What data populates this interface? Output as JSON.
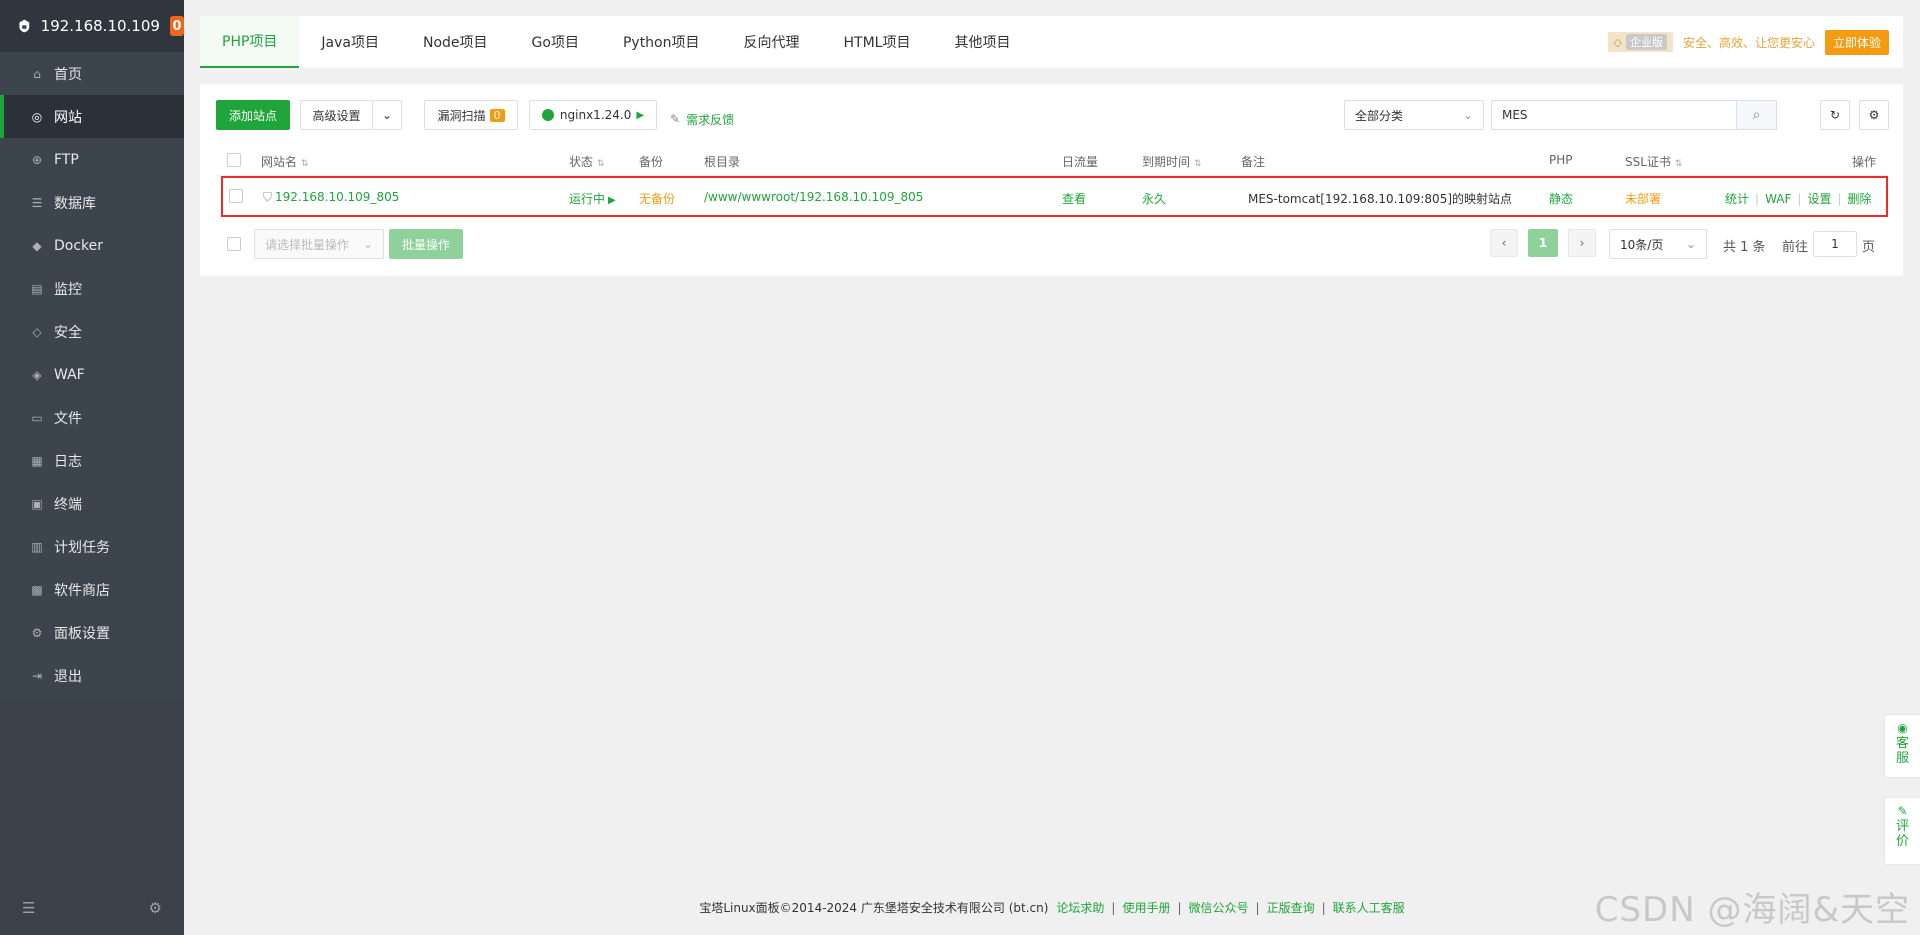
{
  "sidebar": {
    "host": "192.168.10.109",
    "badge": "0",
    "items": [
      {
        "label": "首页",
        "icon": "home-icon"
      },
      {
        "label": "网站",
        "icon": "globe-icon",
        "active": true
      },
      {
        "label": "FTP",
        "icon": "ftp-icon"
      },
      {
        "label": "数据库",
        "icon": "database-icon"
      },
      {
        "label": "Docker",
        "icon": "docker-icon"
      },
      {
        "label": "监控",
        "icon": "monitor-icon"
      },
      {
        "label": "安全",
        "icon": "shield-icon"
      },
      {
        "label": "WAF",
        "icon": "waf-icon"
      },
      {
        "label": "文件",
        "icon": "folder-icon"
      },
      {
        "label": "日志",
        "icon": "log-icon"
      },
      {
        "label": "终端",
        "icon": "terminal-icon"
      },
      {
        "label": "计划任务",
        "icon": "schedule-icon"
      },
      {
        "label": "软件商店",
        "icon": "store-icon"
      },
      {
        "label": "面板设置",
        "icon": "settings-icon"
      },
      {
        "label": "退出",
        "icon": "logout-icon"
      }
    ]
  },
  "tabs": [
    "PHP项目",
    "Java项目",
    "Node项目",
    "Go项目",
    "Python项目",
    "反向代理",
    "HTML项目",
    "其他项目"
  ],
  "promo": {
    "edition": "企业版",
    "slogan": "安全、高效、让您更安心",
    "try_label": "立即体验"
  },
  "toolbar": {
    "add_site": "添加站点",
    "advanced": "高级设置",
    "vuln_scan": "漏洞扫描",
    "vuln_count": "0",
    "nginx": "nginx1.24.0",
    "feedback": "需求反馈",
    "category": "全部分类",
    "search_value": "MES"
  },
  "table": {
    "headers": {
      "name": "网站名",
      "status": "状态",
      "backup": "备份",
      "root": "根目录",
      "traffic": "日流量",
      "expire": "到期时间",
      "remark": "备注",
      "php": "PHP",
      "ssl": "SSL证书",
      "actions": "操作"
    },
    "row": {
      "name": "192.168.10.109_805",
      "status": "运行中",
      "backup": "无备份",
      "root": "/www/wwwroot/192.168.10.109_805",
      "traffic": "查看",
      "expire": "永久",
      "remark": "MES-tomcat[192.168.10.109:805]的映射站点",
      "php": "静态",
      "ssl": "未部署",
      "actions": [
        "统计",
        "WAF",
        "设置",
        "删除"
      ]
    }
  },
  "batch": {
    "select_placeholder": "请选择批量操作",
    "batch_label": "批量操作"
  },
  "pagination": {
    "current": "1",
    "per_page": "10条/页",
    "total": "共 1 条",
    "goto_prefix": "前往",
    "goto_value": "1",
    "goto_suffix": "页"
  },
  "float": {
    "service": [
      "客",
      "服"
    ],
    "review": [
      "评",
      "价"
    ]
  },
  "footer": {
    "copyright": "宝塔Linux面板©2014-2024 广东堡塔安全技术有限公司 (bt.cn)",
    "links": [
      "论坛求助",
      "使用手册",
      "微信公众号",
      "正版查询",
      "联系人工客服"
    ]
  },
  "watermark": "CSDN @海阔&天空",
  "colors": {
    "accent": "#20a53a",
    "warning": "#f39c12",
    "sidebar": "#3c444d",
    "highlight_border": "#ee2a2a"
  }
}
